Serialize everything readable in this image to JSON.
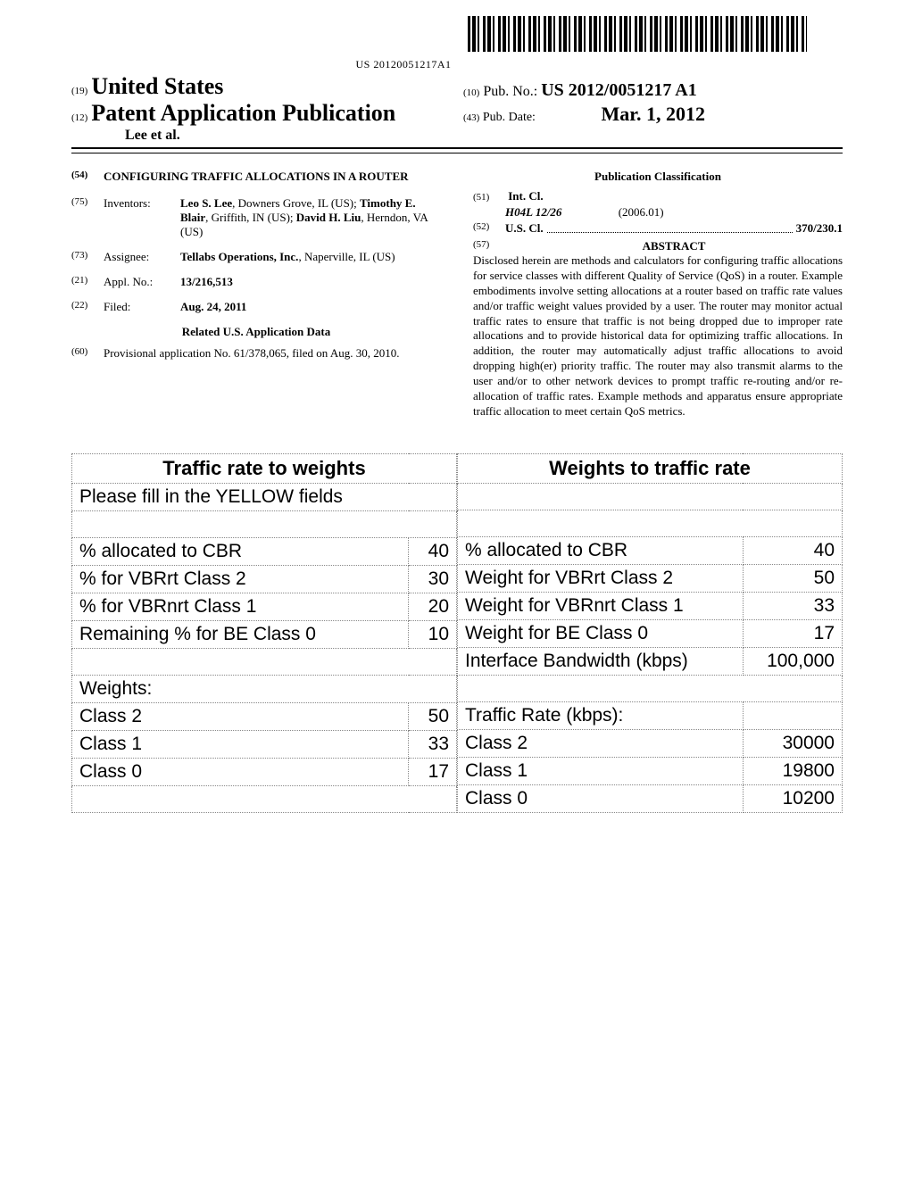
{
  "barcode_text": "US 20120051217A1",
  "header": {
    "country_tag": "(19)",
    "country": "United States",
    "pub_type_tag": "(12)",
    "pub_type": "Patent Application Publication",
    "authors": "Lee et al.",
    "pub_no_tag": "(10)",
    "pub_no_label": "Pub. No.:",
    "pub_no": "US 2012/0051217 A1",
    "pub_date_tag": "(43)",
    "pub_date_label": "Pub. Date:",
    "pub_date": "Mar. 1, 2012"
  },
  "left": {
    "title_tag": "(54)",
    "title": "CONFIGURING TRAFFIC ALLOCATIONS IN A ROUTER",
    "inventors_tag": "(75)",
    "inventors_label": "Inventors:",
    "inventors_value": "Leo S. Lee, Downers Grove, IL (US); Timothy E. Blair, Griffith, IN (US); David H. Liu, Herndon, VA (US)",
    "assignee_tag": "(73)",
    "assignee_label": "Assignee:",
    "assignee_value": "Tellabs Operations, Inc., Naperville, IL (US)",
    "applno_tag": "(21)",
    "applno_label": "Appl. No.:",
    "applno_value": "13/216,513",
    "filed_tag": "(22)",
    "filed_label": "Filed:",
    "filed_value": "Aug. 24, 2011",
    "related_hdr": "Related U.S. Application Data",
    "prov_tag": "(60)",
    "prov_text": "Provisional application No. 61/378,065, filed on Aug. 30, 2010."
  },
  "right": {
    "pub_class_hdr": "Publication Classification",
    "intcl_tag": "(51)",
    "intcl_label": "Int. Cl.",
    "intcl_code": "H04L 12/26",
    "intcl_date": "(2006.01)",
    "uscl_tag": "(52)",
    "uscl_label": "U.S. Cl.",
    "uscl_value": "370/230.1",
    "abstract_tag": "(57)",
    "abstract_hdr": "ABSTRACT",
    "abstract_body": "Disclosed herein are methods and calculators for configuring traffic allocations for service classes with different Quality of Service (QoS) in a router. Example embodiments involve setting allocations at a router based on traffic rate values and/or traffic weight values provided by a user. The router may monitor actual traffic rates to ensure that traffic is not being dropped due to improper rate allocations and to provide historical data for optimizing traffic allocations. In addition, the router may automatically adjust traffic allocations to avoid dropping high(er) priority traffic. The router may also transmit alarms to the user and/or to other network devices to prompt traffic re-routing and/or re-allocation of traffic rates. Example methods and apparatus ensure appropriate traffic allocation to meet certain QoS metrics."
  },
  "figure": {
    "left": {
      "header": "Traffic rate to weights",
      "instruction": "Please fill in the YELLOW fields",
      "rows1": [
        {
          "label": "% allocated to CBR",
          "value": "40"
        },
        {
          "label": "% for VBRrt Class 2",
          "value": "30"
        },
        {
          "label": "% for VBRnrt Class 1",
          "value": "20"
        },
        {
          "label": "Remaining % for BE Class 0",
          "value": "10"
        }
      ],
      "weights_hdr": "Weights:",
      "rows2": [
        {
          "label": "Class 2",
          "value": "50"
        },
        {
          "label": "Class 1",
          "value": "33"
        },
        {
          "label": "Class 0",
          "value": "17"
        }
      ]
    },
    "right": {
      "header": "Weights to traffic rate",
      "rows1": [
        {
          "label": "% allocated to CBR",
          "value": "40"
        },
        {
          "label": "Weight for VBRrt Class 2",
          "value": "50"
        },
        {
          "label": "Weight for VBRnrt Class 1",
          "value": "33"
        },
        {
          "label": "Weight for BE Class 0",
          "value": "17"
        },
        {
          "label": "Interface Bandwidth (kbps)",
          "value": "100,000"
        }
      ],
      "rate_hdr": "Traffic Rate (kbps):",
      "rows2": [
        {
          "label": "Class 2",
          "value": "30000"
        },
        {
          "label": "Class 1",
          "value": "19800"
        },
        {
          "label": "Class 0",
          "value": "10200"
        }
      ]
    }
  }
}
